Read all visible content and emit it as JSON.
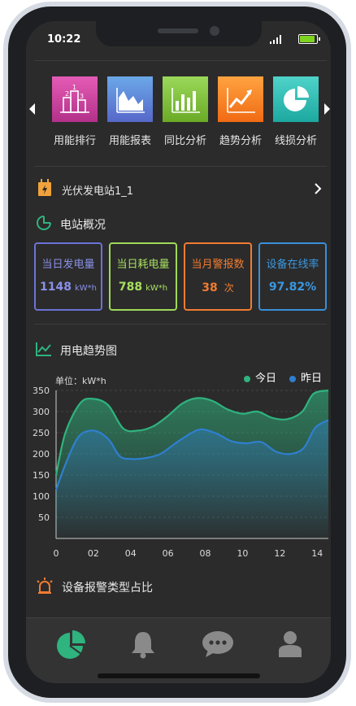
{
  "status": {
    "time": "10:22"
  },
  "menu": {
    "items": [
      {
        "label": "用能排行",
        "icon": "ranking-chart-icon",
        "color_top": "#e45bb5",
        "color_bottom": "#b3318a"
      },
      {
        "label": "用能报表",
        "icon": "area-chart-icon",
        "color_top": "#6ba8e8",
        "color_bottom": "#5667c9"
      },
      {
        "label": "同比分析",
        "icon": "bar-chart-icon",
        "color_top": "#9bd85a",
        "color_bottom": "#6aaa26"
      },
      {
        "label": "趋势分析",
        "icon": "trend-chart-icon",
        "color_top": "#ffa340",
        "color_bottom": "#f06a14"
      },
      {
        "label": "线损分析",
        "icon": "pie-chart-icon",
        "color_top": "#4fd3c9",
        "color_bottom": "#1ca8a0"
      }
    ]
  },
  "station": {
    "name": "光伏发电站1_1"
  },
  "overview": {
    "title": "电站概况",
    "cards": [
      {
        "label": "当日发电量",
        "value": "1148",
        "unit": "kW*h",
        "color": "#6a73d6",
        "label_color": "#8a90e8"
      },
      {
        "label": "当日耗电量",
        "value": "788",
        "unit": "kW*h",
        "color": "#9fd95a",
        "label_color": "#a7e05f"
      },
      {
        "label": "当月警报数",
        "value": "38",
        "unit": "次",
        "color": "#f07c32",
        "label_color": "#f07c32"
      },
      {
        "label": "设备在线率",
        "value": "97.82%",
        "unit": "",
        "color": "#3a8fd9",
        "label_color": "#3a97e0"
      }
    ]
  },
  "trend": {
    "title": "用电趋势图",
    "unit_label": "单位：kW*h"
  },
  "alarm": {
    "title": "设备报警类型占比"
  },
  "colors": {
    "today": "#2fb37f",
    "yesterday": "#2f7fd0"
  },
  "chart_data": {
    "type": "area",
    "x": [
      0,
      2,
      4,
      6,
      8,
      10,
      12,
      14
    ],
    "x_tick_labels": [
      "0",
      "02",
      "04",
      "06",
      "08",
      "10",
      "12",
      "14"
    ],
    "xlim": [
      0,
      14.6
    ],
    "ylim": [
      0,
      350
    ],
    "y_ticks": [
      50,
      100,
      150,
      200,
      250,
      300,
      350
    ],
    "ylabel": "单位：kW*h",
    "legend_position": "top-right",
    "grid": true,
    "series": [
      {
        "name": "今日",
        "color": "#2fb37f",
        "points": [
          [
            0,
            150
          ],
          [
            0.5,
            250
          ],
          [
            1.3,
            320
          ],
          [
            2,
            330
          ],
          [
            2.8,
            315
          ],
          [
            3.6,
            260
          ],
          [
            4.4,
            255
          ],
          [
            5.2,
            265
          ],
          [
            6,
            290
          ],
          [
            6.8,
            320
          ],
          [
            7.6,
            332
          ],
          [
            8.4,
            325
          ],
          [
            9.2,
            305
          ],
          [
            10,
            295
          ],
          [
            10.8,
            300
          ],
          [
            11.6,
            285
          ],
          [
            12.4,
            282
          ],
          [
            13.2,
            300
          ],
          [
            13.8,
            342
          ],
          [
            14.6,
            355
          ]
        ]
      },
      {
        "name": "昨日",
        "color": "#2f7fd0",
        "points": [
          [
            0,
            115
          ],
          [
            0.5,
            175
          ],
          [
            1.2,
            240
          ],
          [
            2,
            255
          ],
          [
            2.8,
            235
          ],
          [
            3.4,
            195
          ],
          [
            4,
            188
          ],
          [
            4.8,
            190
          ],
          [
            5.6,
            200
          ],
          [
            6.4,
            225
          ],
          [
            7.2,
            248
          ],
          [
            7.8,
            258
          ],
          [
            8.6,
            248
          ],
          [
            9.4,
            230
          ],
          [
            10.2,
            225
          ],
          [
            11,
            228
          ],
          [
            11.8,
            205
          ],
          [
            12.6,
            200
          ],
          [
            13.3,
            215
          ],
          [
            13.9,
            262
          ],
          [
            14.6,
            280
          ]
        ]
      }
    ]
  }
}
